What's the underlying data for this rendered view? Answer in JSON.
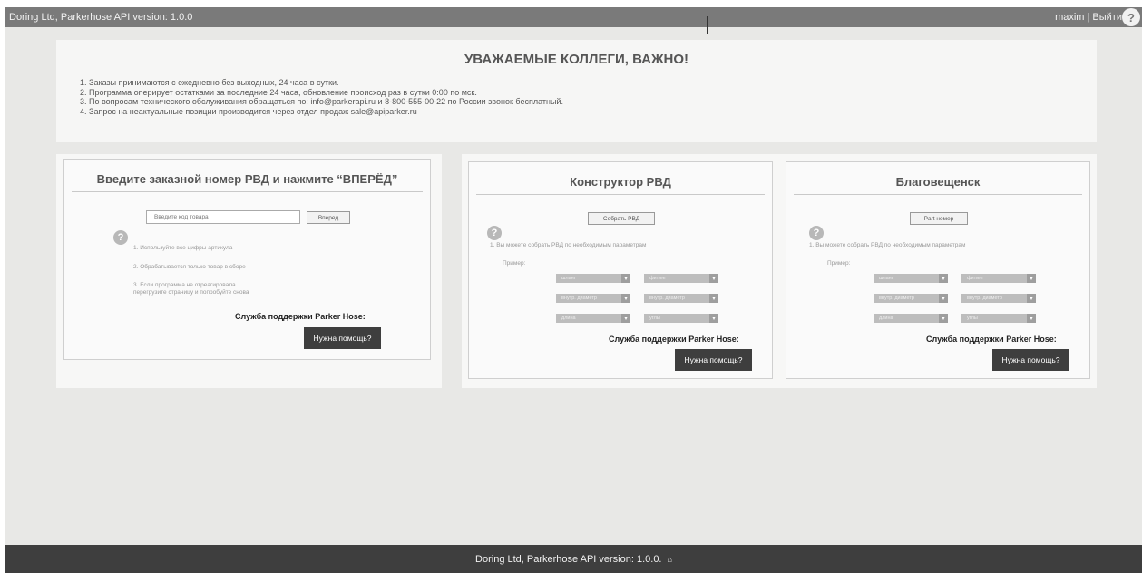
{
  "topbar": {
    "brand": "Doring Ltd, Parkerhose API version: 1.0.0",
    "user": "maxim | Выйти",
    "help": "?"
  },
  "notice": {
    "title": "УВАЖАЕМЫЕ КОЛЛЕГИ, ВАЖНО!",
    "items": [
      "1. Заказы принимаются с ежедневно без выходных, 24 часа в сутки.",
      "2. Программа оперирует остатками за последние 24 часа, обновление происход раз в сутки 0:00 по мск.",
      "3. По вопросам технического обслуживания обращаться по: info@parkerapi.ru и 8-800-555-00-22 по России звонок бесплатный.",
      "4. Запрос на неактуальные позиции производится через отдел продаж sale@apiparker.ru"
    ]
  },
  "order_card": {
    "title": "Введите заказной номер РВД и нажмите “ВПЕРЁД”",
    "input_placeholder": "Введите код товара",
    "forward_button": "Вперед",
    "tips": [
      "1. Используйте все цифры артикула",
      "2. Обрабатывается только товар в сборе",
      "3. Если программа не отреагировала перегрузите страницу и попробуйте снова"
    ],
    "support_label": "Служба поддержки Parker Hose:",
    "help_button": "Нужна помощь?"
  },
  "constructor_card": {
    "title": "Конструктор РВД",
    "assemble_button": "Собрать РВД",
    "tip": "1. Вы можете собрать РВД по необходимым параметрам",
    "example_label": "Пример:",
    "selects": [
      "шланг",
      "фитинг",
      "внутр. диаметр",
      "внутр. диаметр",
      "длина",
      "углы"
    ],
    "support_label": "Служба поддержки Parker Hose:",
    "help_button": "Нужна помощь?"
  },
  "blag_card": {
    "title": "Благовещенск",
    "part_button": "Part номер",
    "tip": "1. Вы можете собрать РВД по необходимым параметрам",
    "example_label": "Пример:",
    "selects": [
      "шланг",
      "фитинг",
      "внутр. диаметр",
      "внутр. диаметр",
      "длина",
      "углы"
    ],
    "support_label": "Служба поддержки Parker Hose:",
    "help_button": "Нужна помощь?"
  },
  "footer": {
    "text": "Doring Ltd, Parkerhose API version: 1.0.0.",
    "icon": "home-icon"
  }
}
